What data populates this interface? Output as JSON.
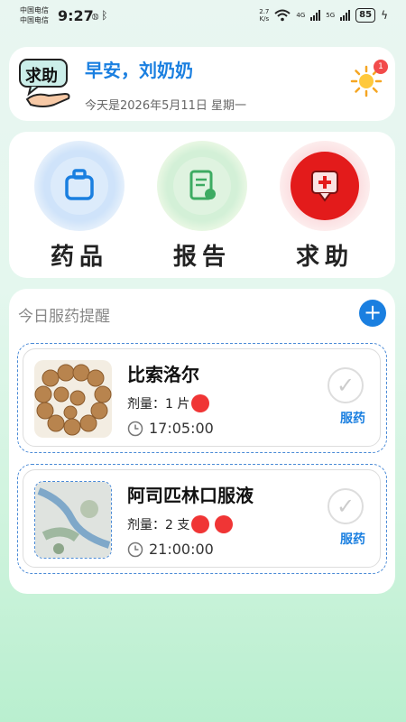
{
  "status_bar": {
    "carrier_1": "中国电信",
    "carrier_2": "中国电信",
    "time": "9:27",
    "speed_value": "2.7",
    "speed_unit": "K/s",
    "network_1": "4G",
    "network_2": "5G",
    "battery": "85"
  },
  "greeting": {
    "help_logo_text": "求助",
    "title": "早安，刘奶奶",
    "date": "今天是2026年5月11日 星期一",
    "notification_count": "1"
  },
  "functions": [
    {
      "label": "药品",
      "icon": "bag-icon",
      "color": "#1a7fe0"
    },
    {
      "label": "报告",
      "icon": "report-icon",
      "color": "#3dab62"
    },
    {
      "label": "求助",
      "icon": "medical-cross-icon",
      "color": "#e62222"
    }
  ],
  "reminders": {
    "title": "今日服药提醒",
    "add_icon": "plus-icon",
    "items": [
      {
        "name": "比索洛尔",
        "dose": "剂量：1 片",
        "time": "17:05:00",
        "action": "服药",
        "red_dots": 1
      },
      {
        "name": "阿司匹林口服液",
        "dose": "剂量：2 支",
        "time": "21:00:00",
        "action": "服药",
        "red_dots": 2
      }
    ]
  },
  "colors": {
    "accent": "#1a7fe0",
    "badge": "#f24b4b",
    "dot": "#f03535"
  }
}
